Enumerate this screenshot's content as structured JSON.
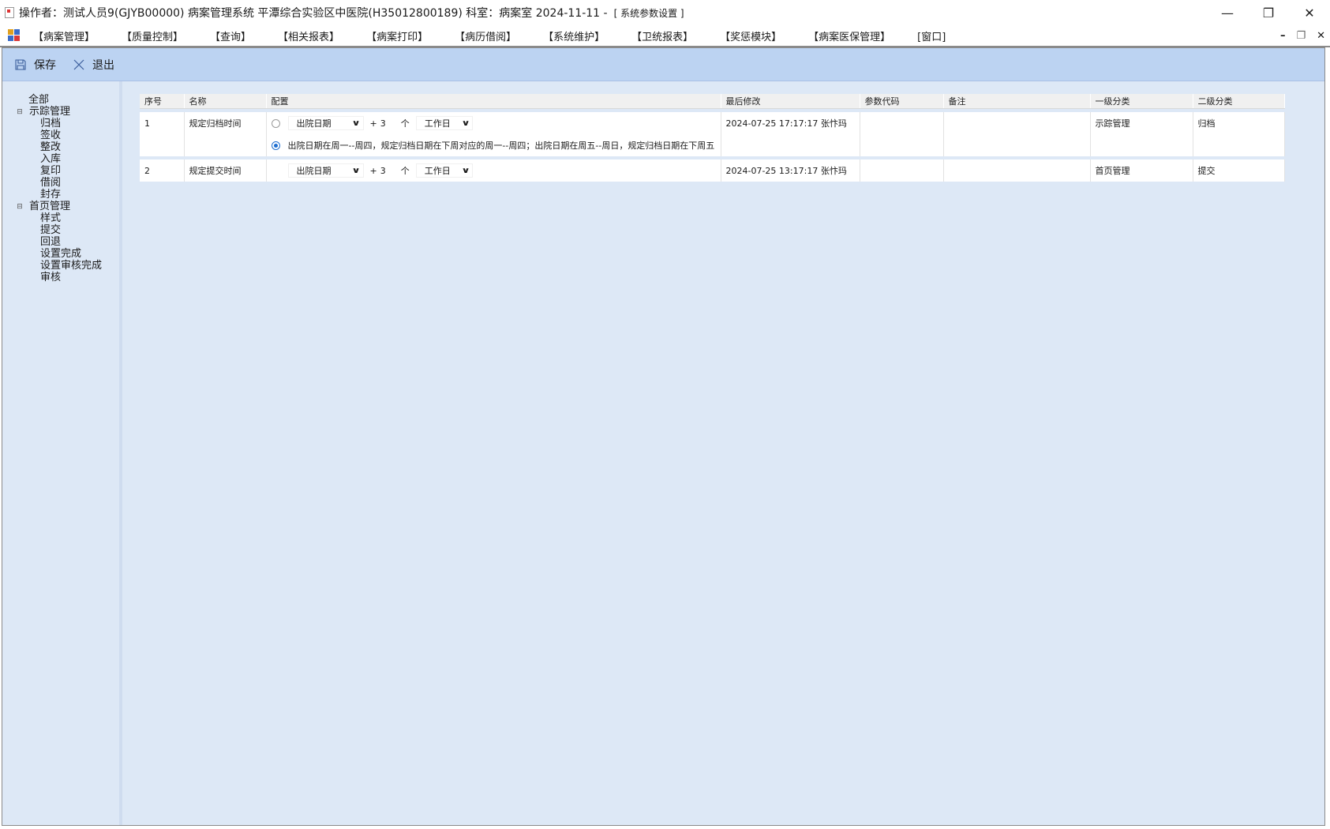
{
  "window": {
    "title": "操作者：测试人员9(GJYB00000) 病案管理系统  平潭综合实验区中医院(H35012800189)  科室：病案室 2024-11-11  -",
    "subtitle": "[ 系统参数设置 ]",
    "controls": {
      "minimize": "—",
      "restore": "❐",
      "close": "✕"
    }
  },
  "menu": {
    "items": [
      "【病案管理】",
      "【质量控制】",
      "【查询】",
      "【相关报表】",
      "【病案打印】",
      "【病历借阅】",
      "【系统维护】",
      "【卫统报表】",
      "【奖惩模块】",
      "【病案医保管理】",
      "[窗口]"
    ],
    "mdi_controls": {
      "minimize": "–",
      "restore": "❐",
      "close": "✕"
    }
  },
  "toolbar": {
    "save_label": "保存",
    "exit_label": "退出"
  },
  "tree": {
    "all": "全部",
    "groups": [
      {
        "label": "示踪管理",
        "expander": "⊟",
        "children": [
          "归档",
          "签收",
          "整改",
          "入库",
          "复印",
          "借阅",
          "封存"
        ]
      },
      {
        "label": "首页管理",
        "expander": "⊟",
        "children": [
          "样式",
          "提交",
          "回退",
          "设置完成",
          "设置审核完成",
          "审核"
        ]
      }
    ]
  },
  "grid": {
    "headers": [
      "序号",
      "名称",
      "配置",
      "最后修改",
      "参数代码",
      "备注",
      "一级分类",
      "二级分类"
    ],
    "rows": [
      {
        "seq": "1",
        "name": "规定归档时间",
        "config": {
          "option1": {
            "selected": false,
            "base": "出院日期",
            "plus": "+",
            "count": "3",
            "unit": "个",
            "day_type": "工作日"
          },
          "option2": {
            "selected": true,
            "text": "出院日期在周一--周四，规定归档日期在下周对应的周一--周四；出院日期在周五--周日，规定归档日期在下周五"
          }
        },
        "modified": "2024-07-25  17:17:17  张忭玛",
        "param_code": "",
        "remark": "",
        "cat1": "示踪管理",
        "cat2": "归档"
      },
      {
        "seq": "2",
        "name": "规定提交时间",
        "config": {
          "option1": {
            "base": "出院日期",
            "plus": "+",
            "count": "3",
            "unit": "个",
            "day_type": "工作日"
          }
        },
        "modified": "2024-07-25  13:17:17  张忭玛",
        "param_code": "",
        "remark": "",
        "cat1": "首页管理",
        "cat2": "提交"
      }
    ]
  },
  "colors": {
    "frame_bg": "#dde8f6",
    "toolbar_bg": "#bcd3f2",
    "radio_accent": "#1f6fd0"
  }
}
